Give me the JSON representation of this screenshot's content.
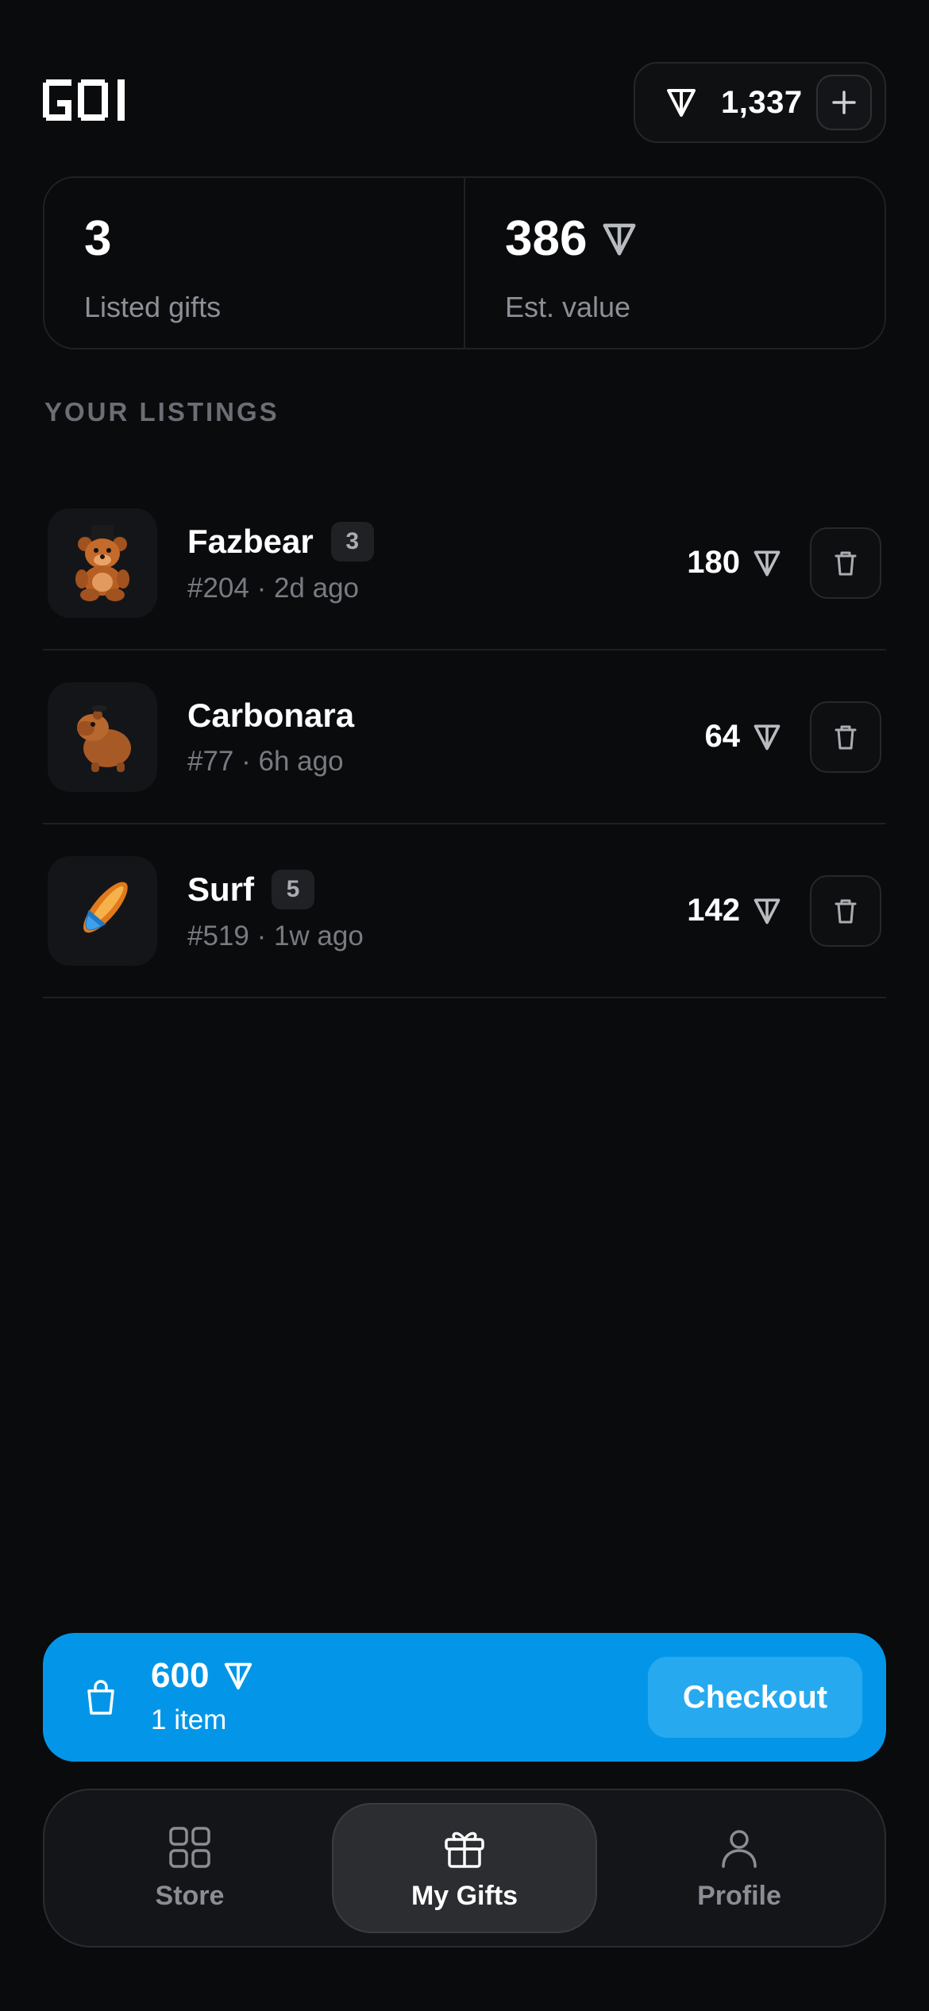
{
  "header": {
    "logo_text": "GOI",
    "balance": "1,337",
    "add_icon": "plus-icon",
    "currency_icon": "ton-icon"
  },
  "stats": {
    "listed_value": "3",
    "listed_label": "Listed gifts",
    "est_value": "386",
    "est_label": "Est. value"
  },
  "section_title": "YOUR LISTINGS",
  "listings": [
    {
      "name": "Fazbear",
      "badge": "3",
      "meta": "#204 · 2d ago",
      "price": "180",
      "thumb": "teddy-bear-icon"
    },
    {
      "name": "Carbonara",
      "badge": "",
      "meta": "#77 · 6h ago",
      "price": "64",
      "thumb": "capybara-icon"
    },
    {
      "name": "Surf",
      "badge": "5",
      "meta": "#519 · 1w ago",
      "price": "142",
      "thumb": "surfboard-icon"
    }
  ],
  "cart": {
    "total": "600",
    "count": "1 item",
    "checkout_label": "Checkout",
    "icon": "shopping-bag-icon"
  },
  "nav": [
    {
      "label": "Store",
      "icon": "grid-icon",
      "active": false
    },
    {
      "label": "My Gifts",
      "icon": "gift-icon",
      "active": true
    },
    {
      "label": "Profile",
      "icon": "user-icon",
      "active": false
    }
  ],
  "colors": {
    "background": "#0a0b0d",
    "accent": "#0396e8",
    "checkout_button": "#27a9f0",
    "muted_text": "#8c8f95"
  }
}
